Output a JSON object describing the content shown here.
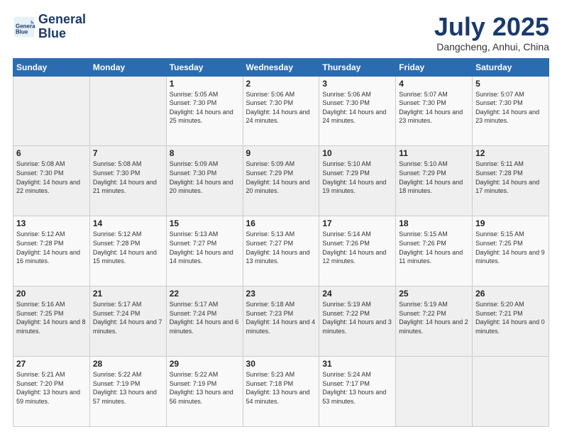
{
  "logo": {
    "line1": "General",
    "line2": "Blue"
  },
  "title": "July 2025",
  "subtitle": "Dangcheng, Anhui, China",
  "headers": [
    "Sunday",
    "Monday",
    "Tuesday",
    "Wednesday",
    "Thursday",
    "Friday",
    "Saturday"
  ],
  "weeks": [
    [
      {
        "day": "",
        "info": ""
      },
      {
        "day": "",
        "info": ""
      },
      {
        "day": "1",
        "info": "Sunrise: 5:05 AM\nSunset: 7:30 PM\nDaylight: 14 hours and 25 minutes."
      },
      {
        "day": "2",
        "info": "Sunrise: 5:06 AM\nSunset: 7:30 PM\nDaylight: 14 hours and 24 minutes."
      },
      {
        "day": "3",
        "info": "Sunrise: 5:06 AM\nSunset: 7:30 PM\nDaylight: 14 hours and 24 minutes."
      },
      {
        "day": "4",
        "info": "Sunrise: 5:07 AM\nSunset: 7:30 PM\nDaylight: 14 hours and 23 minutes."
      },
      {
        "day": "5",
        "info": "Sunrise: 5:07 AM\nSunset: 7:30 PM\nDaylight: 14 hours and 23 minutes."
      }
    ],
    [
      {
        "day": "6",
        "info": "Sunrise: 5:08 AM\nSunset: 7:30 PM\nDaylight: 14 hours and 22 minutes."
      },
      {
        "day": "7",
        "info": "Sunrise: 5:08 AM\nSunset: 7:30 PM\nDaylight: 14 hours and 21 minutes."
      },
      {
        "day": "8",
        "info": "Sunrise: 5:09 AM\nSunset: 7:30 PM\nDaylight: 14 hours and 20 minutes."
      },
      {
        "day": "9",
        "info": "Sunrise: 5:09 AM\nSunset: 7:29 PM\nDaylight: 14 hours and 20 minutes."
      },
      {
        "day": "10",
        "info": "Sunrise: 5:10 AM\nSunset: 7:29 PM\nDaylight: 14 hours and 19 minutes."
      },
      {
        "day": "11",
        "info": "Sunrise: 5:10 AM\nSunset: 7:29 PM\nDaylight: 14 hours and 18 minutes."
      },
      {
        "day": "12",
        "info": "Sunrise: 5:11 AM\nSunset: 7:28 PM\nDaylight: 14 hours and 17 minutes."
      }
    ],
    [
      {
        "day": "13",
        "info": "Sunrise: 5:12 AM\nSunset: 7:28 PM\nDaylight: 14 hours and 16 minutes."
      },
      {
        "day": "14",
        "info": "Sunrise: 5:12 AM\nSunset: 7:28 PM\nDaylight: 14 hours and 15 minutes."
      },
      {
        "day": "15",
        "info": "Sunrise: 5:13 AM\nSunset: 7:27 PM\nDaylight: 14 hours and 14 minutes."
      },
      {
        "day": "16",
        "info": "Sunrise: 5:13 AM\nSunset: 7:27 PM\nDaylight: 14 hours and 13 minutes."
      },
      {
        "day": "17",
        "info": "Sunrise: 5:14 AM\nSunset: 7:26 PM\nDaylight: 14 hours and 12 minutes."
      },
      {
        "day": "18",
        "info": "Sunrise: 5:15 AM\nSunset: 7:26 PM\nDaylight: 14 hours and 11 minutes."
      },
      {
        "day": "19",
        "info": "Sunrise: 5:15 AM\nSunset: 7:25 PM\nDaylight: 14 hours and 9 minutes."
      }
    ],
    [
      {
        "day": "20",
        "info": "Sunrise: 5:16 AM\nSunset: 7:25 PM\nDaylight: 14 hours and 8 minutes."
      },
      {
        "day": "21",
        "info": "Sunrise: 5:17 AM\nSunset: 7:24 PM\nDaylight: 14 hours and 7 minutes."
      },
      {
        "day": "22",
        "info": "Sunrise: 5:17 AM\nSunset: 7:24 PM\nDaylight: 14 hours and 6 minutes."
      },
      {
        "day": "23",
        "info": "Sunrise: 5:18 AM\nSunset: 7:23 PM\nDaylight: 14 hours and 4 minutes."
      },
      {
        "day": "24",
        "info": "Sunrise: 5:19 AM\nSunset: 7:22 PM\nDaylight: 14 hours and 3 minutes."
      },
      {
        "day": "25",
        "info": "Sunrise: 5:19 AM\nSunset: 7:22 PM\nDaylight: 14 hours and 2 minutes."
      },
      {
        "day": "26",
        "info": "Sunrise: 5:20 AM\nSunset: 7:21 PM\nDaylight: 14 hours and 0 minutes."
      }
    ],
    [
      {
        "day": "27",
        "info": "Sunrise: 5:21 AM\nSunset: 7:20 PM\nDaylight: 13 hours and 59 minutes."
      },
      {
        "day": "28",
        "info": "Sunrise: 5:22 AM\nSunset: 7:19 PM\nDaylight: 13 hours and 57 minutes."
      },
      {
        "day": "29",
        "info": "Sunrise: 5:22 AM\nSunset: 7:19 PM\nDaylight: 13 hours and 56 minutes."
      },
      {
        "day": "30",
        "info": "Sunrise: 5:23 AM\nSunset: 7:18 PM\nDaylight: 13 hours and 54 minutes."
      },
      {
        "day": "31",
        "info": "Sunrise: 5:24 AM\nSunset: 7:17 PM\nDaylight: 13 hours and 53 minutes."
      },
      {
        "day": "",
        "info": ""
      },
      {
        "day": "",
        "info": ""
      }
    ]
  ]
}
